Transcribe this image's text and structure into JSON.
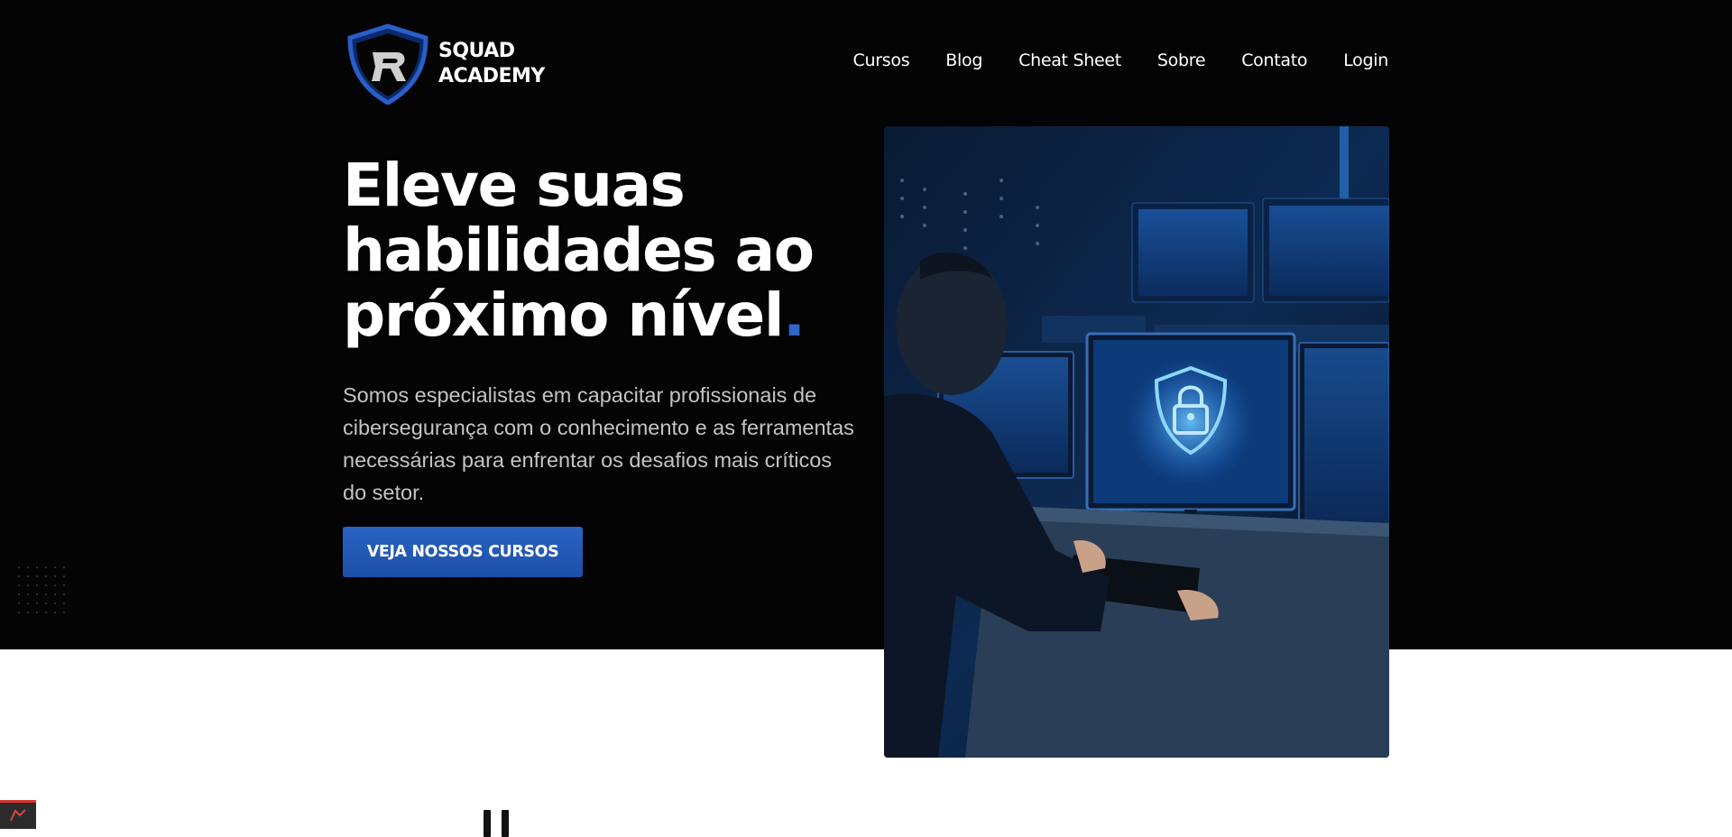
{
  "brand": {
    "line1": "SQUAD",
    "line2": "ACADEMY",
    "accent": "#2f64c8"
  },
  "nav": {
    "items": [
      "Cursos",
      "Blog",
      "Cheat Sheet",
      "Sobre",
      "Contato",
      "Login"
    ]
  },
  "hero": {
    "headline_line1": "Eleve suas",
    "headline_line2": "habilidades ao",
    "headline_line3": "próximo nível",
    "headline_dot": ".",
    "lead": "Somos especialistas em capacitar profissionais de cibersegurança com o conhecimento e as ferramentas necessárias para enfrentar os desafios mais críticos do setor.",
    "cta_label": "VEJA NOSSOS CURSOS",
    "image_icon": "lock-shield-icon"
  },
  "colors": {
    "hero_bg": "#040404",
    "button": "#2a63c4",
    "lead_text": "#c4c4c4"
  }
}
